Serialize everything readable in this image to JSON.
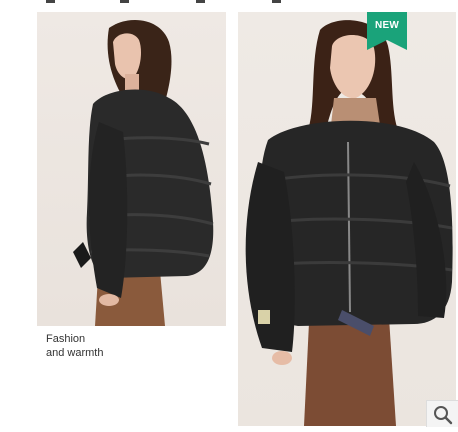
{
  "badge": {
    "label": "NEW",
    "color": "#1aa37a"
  },
  "caption": {
    "line1": "Fashion",
    "line2": "and warmth"
  },
  "images": [
    {
      "name": "model-side-view",
      "description_icon": "photo"
    },
    {
      "name": "model-front-view",
      "description_icon": "photo"
    }
  ],
  "zoom": {
    "icon": "magnifier-icon"
  }
}
